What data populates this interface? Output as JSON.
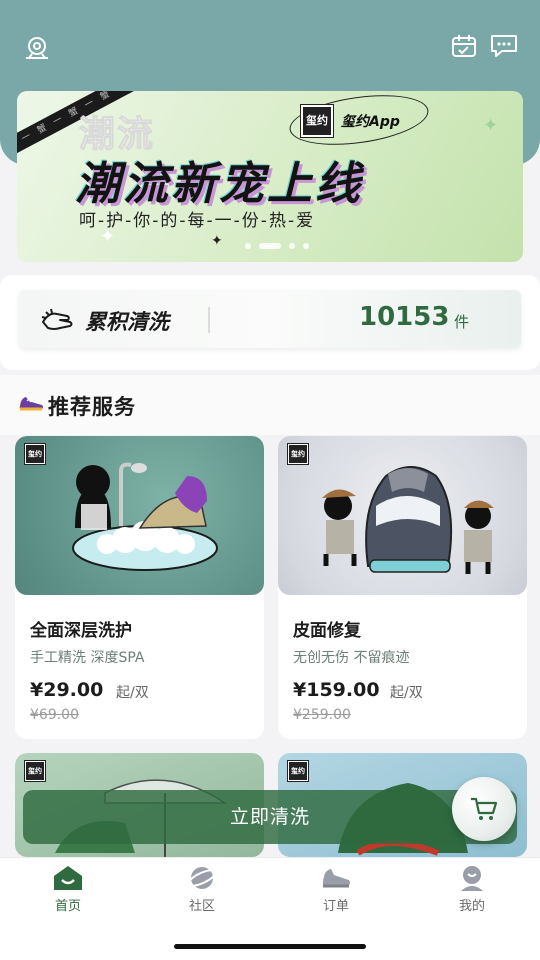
{
  "header": {
    "location_icon": "location-pin-icon",
    "calendar_icon": "calendar-check-icon",
    "message_icon": "chat-bubble-icon"
  },
  "banner": {
    "title": "潮流新宠上线",
    "shadow_title": "潮流",
    "subtitle": "呵-护-你-的-每-一-份-热-爱",
    "badge_logo": "玺约",
    "badge_text": "玺约App",
    "tape_text": "蟹 一 蟹 一 蟹 一 蟹 一 蟹",
    "slide_count": 4,
    "active_slide": 2
  },
  "stats": {
    "label": "累积清洗",
    "value": "10153",
    "unit": "件",
    "icon": "hand-wash-icon"
  },
  "section": {
    "title": "推荐服务",
    "icon": "sneaker-icon"
  },
  "services": [
    {
      "badge": "玺约",
      "title": "全面深层洗护",
      "desc": "手工精洗 深度SPA",
      "price": "¥29.00",
      "unit": "起/双",
      "original": "¥69.00",
      "bg": "#6e9f94"
    },
    {
      "badge": "玺约",
      "title": "皮面修复",
      "desc": "无创无伤 不留痕迹",
      "price": "¥159.00",
      "unit": "起/双",
      "original": "¥259.00",
      "bg": "#dfe2e8"
    },
    {
      "badge": "玺约",
      "bg": "#9ebfa6"
    },
    {
      "badge": "玺约",
      "bg": "#9fc6d4"
    }
  ],
  "cta": {
    "label": "立即清洗",
    "cart_icon": "shopping-cart-icon"
  },
  "tabs": [
    {
      "label": "首页",
      "icon": "home-icon",
      "active": true
    },
    {
      "label": "社区",
      "icon": "planet-icon",
      "active": false
    },
    {
      "label": "订单",
      "icon": "sneaker-order-icon",
      "active": false
    },
    {
      "label": "我的",
      "icon": "profile-icon",
      "active": false
    }
  ],
  "colors": {
    "header": "#7aa8a8",
    "accent": "#2f6a40",
    "muted_text": "#6d7f76"
  }
}
